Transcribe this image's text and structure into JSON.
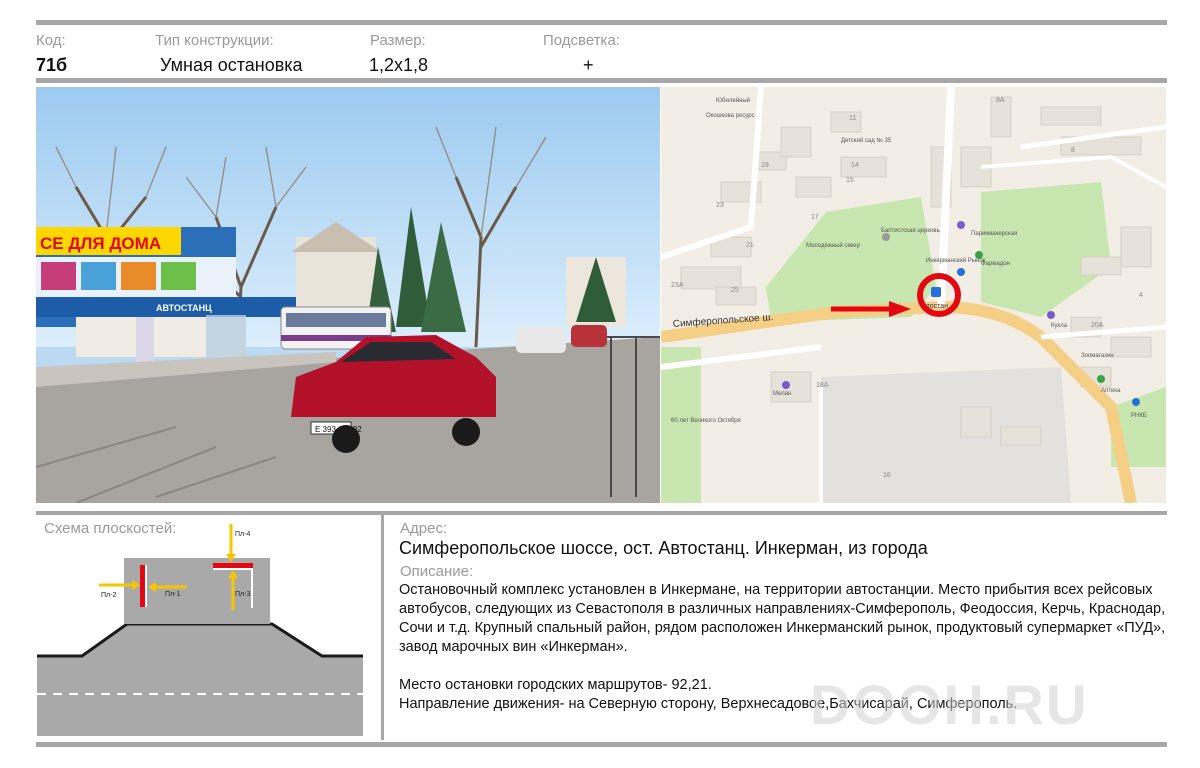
{
  "header": {
    "code_label": "Код:",
    "code_value": "71б",
    "type_label": "Тип конструкции:",
    "type_value": "Умная остановка",
    "size_label": "Размер:",
    "size_value": "1,2х1,8",
    "light_label": "Подсветка:",
    "light_value": "+"
  },
  "photo": {
    "shop_sign": "СЕ ДЛЯ ДОМА",
    "station_sign": "АВТОСТАНЦ",
    "plate": "Е 393 СМ 92"
  },
  "map": {
    "road_label": "Симферопольское ш.",
    "bus_stop_label": "втостан",
    "places": [
      "Молодёжный сквер",
      "Баптистская церковь",
      "Инкерманский Рынок",
      "Фармадон",
      "Парикмахерская",
      "Детский сад № 35",
      "Окошкова ресурс",
      "Юбилейный",
      "Кукла",
      "Зоомагазин",
      "Аптека",
      "РНКБ",
      "Мелан",
      "60 лет Великого Октября"
    ],
    "building_numbers": [
      "11",
      "14",
      "15",
      "17",
      "19",
      "21",
      "23",
      "25",
      "23А",
      "18А",
      "16",
      "8",
      "8А",
      "4",
      "20А"
    ],
    "colors": {
      "road": "#f6cf86",
      "park": "#c8e6b0",
      "block": "#e6e2da",
      "marker": "#e30613"
    }
  },
  "scheme": {
    "label": "Схема плоскостей:",
    "planes": [
      "Пл-1",
      "Пл-2",
      "Пл-3",
      "Пл-4"
    ]
  },
  "address": {
    "label": "Адрес:",
    "value": "Симферопольское шоссе, ост. Автостанц. Инкерман, из города"
  },
  "description": {
    "label": "Описание:",
    "paragraph1": "Остановочный комплекс установлен в Инкермане, на территории автостанции. Место прибытия всех рейсовых автобусов, следующих  из Севастополя в различных направлениях-Симферополь, Феодоссия, Керчь, Краснодар, Сочи и т.д.  Крупный спальный район, рядом расположен  Инкерманский рынок, продуктовый супермаркет «ПУД», завод марочных вин «Инкерман».",
    "paragraph2_line1": "Место остановки городских маршрутов- 92,21.",
    "paragraph2_line2": "Направление движения- на Северную сторону, Верхнесадовое,Бахчисарай, Симферополь."
  },
  "watermark": "DOOH.RU"
}
